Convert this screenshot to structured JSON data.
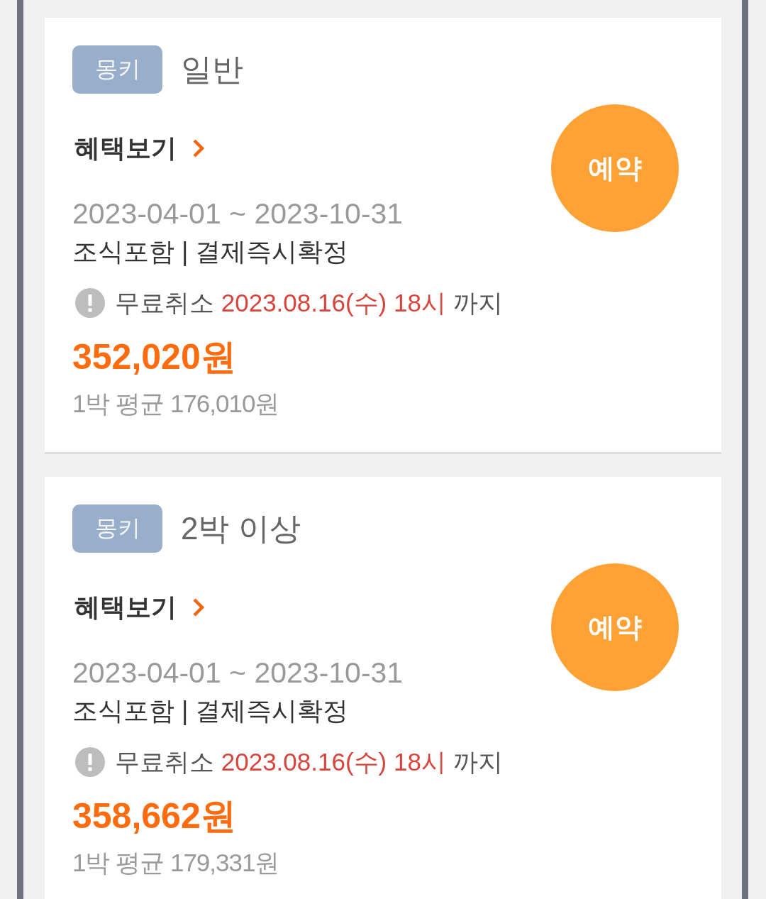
{
  "offers": [
    {
      "badge": "몽키",
      "title": "일반",
      "benefits_link": "혜택보기",
      "period": "2023-04-01 ~ 2023-10-31",
      "conditions": "조식포함 | 결제즉시확정",
      "cancellation": {
        "label": "무료취소",
        "deadline": "2023.08.16(수) 18시",
        "suffix": "까지"
      },
      "price": "352,020원",
      "per_night": "1박 평균 176,010원",
      "reserve_button": "예약"
    },
    {
      "badge": "몽키",
      "title": "2박 이상",
      "benefits_link": "혜택보기",
      "period": "2023-04-01 ~ 2023-10-31",
      "conditions": "조식포함 | 결제즉시확정",
      "cancellation": {
        "label": "무료취소",
        "deadline": "2023.08.16(수) 18시",
        "suffix": "까지"
      },
      "price": "358,662원",
      "per_night": "1박 평균 179,331원",
      "reserve_button": "예약"
    }
  ]
}
